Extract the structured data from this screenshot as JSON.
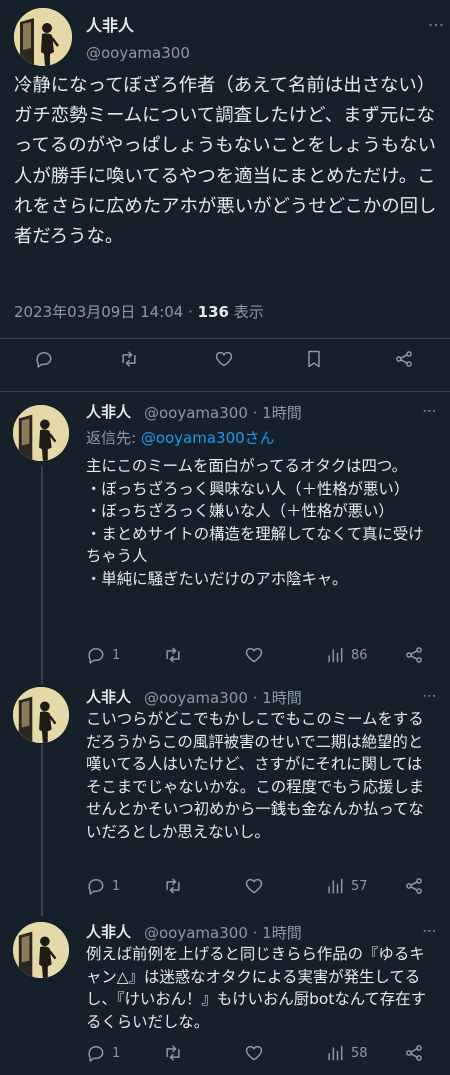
{
  "main_tweet": {
    "display_name": "人非人",
    "handle": "@ooyama300",
    "text": "冷静になってぼざろ作者（あえて名前は出さない）ガチ恋勢ミームについて調査したけど、まず元になってるのがやっぱしょうもないことをしょうもない人が勝手に喚いてるやつを適当にまとめただけ。これをさらに広めたアホが悪いがどうせどこかの回し者だろうな。",
    "timestamp": "2023年03月09日 14:04",
    "separator": " · ",
    "views_count": "136",
    "views_label": " 表示",
    "icons": [
      "reply-icon",
      "retweet-icon",
      "like-icon",
      "bookmark-icon",
      "share-icon"
    ]
  },
  "replies": [
    {
      "display_name": "人非人",
      "handle_time": "@ooyama300 · 1時間",
      "reply_to_label": "返信先: ",
      "reply_to_mention": "@ooyama300さん",
      "text": "主にこのミームを面白がってるオタクは四つ。\n・ぼっちざろっく興味ない人（＋性格が悪い）\n・ぼっちざろっく嫌いな人（＋性格が悪い）\n・まとめサイトの構造を理解してなくて真に受けちゃう人\n・単純に騒ぎたいだけのアホ陰キャ。",
      "reply_count": "1",
      "views": "86"
    },
    {
      "display_name": "人非人",
      "handle_time": "@ooyama300 · 1時間",
      "text": "こいつらがどこでもかしこでもこのミームをするだろうからこの風評被害のせいで二期は絶望的と嘆いてる人はいたけど、さすがにそれに関してはそこまでじゃないかな。この程度でもう応援しませんとかそいつ初めから一銭も金なんか払ってないだろとしか思えないし。",
      "reply_count": "1",
      "views": "57"
    },
    {
      "display_name": "人非人",
      "handle_time": "@ooyama300 · 1時間",
      "text": "例えば前例を上げると同じきらら作品の『ゆるキャン△』は迷惑なオタクによる実害が発生してるし、『けいおん！』もけいおん厨botなんて存在するくらいだしな。",
      "reply_count": "1",
      "views": "58"
    }
  ],
  "more_glyph": "⋮",
  "colors": {
    "background": "#15202b",
    "text": "#e7e9ea",
    "muted": "#8b98a5",
    "link": "#1d9bf0",
    "border": "#38444d"
  }
}
